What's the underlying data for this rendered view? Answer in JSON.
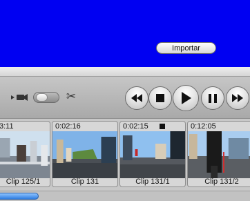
{
  "viewer": {
    "color": "#0000f2"
  },
  "import_button": {
    "label": "Importar"
  },
  "toolbar": {
    "icons": [
      "camera-icon",
      "mode-switch",
      "scissors-icon"
    ],
    "transport": [
      "rewind",
      "stop",
      "play",
      "pause",
      "fast-forward"
    ]
  },
  "clips": [
    {
      "timecode": "3:11",
      "name": "Clip 125/1"
    },
    {
      "timecode": "0:02:16",
      "name": "Clip 131"
    },
    {
      "timecode": "0:02:15",
      "name": "Clip 131/1",
      "badge": "marker"
    },
    {
      "timecode": "0:12:05",
      "name": "Clip 131/2"
    }
  ],
  "accent_color": "#2f7de0"
}
